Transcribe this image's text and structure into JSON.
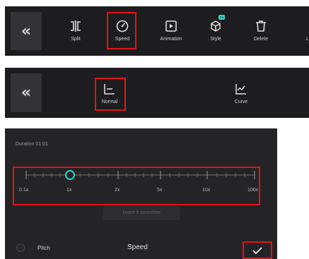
{
  "toolbar": {
    "back_icon": "double-chevron-left",
    "items": [
      {
        "label": "Split",
        "icon": "split-icon"
      },
      {
        "label": "Speed",
        "icon": "speedometer-icon"
      },
      {
        "label": "Animation",
        "icon": "animation-icon"
      },
      {
        "label": "Style",
        "icon": "style-cube-icon",
        "badge": "TV"
      },
      {
        "label": "Delete",
        "icon": "trash-icon"
      },
      {
        "label": "L",
        "icon": "none"
      }
    ]
  },
  "speed_mode": {
    "back_icon": "double-chevron-left",
    "options": [
      {
        "label": "Normal",
        "icon": "normal-chart-icon",
        "selected": true
      },
      {
        "label": "Curve",
        "icon": "curve-chart-icon",
        "selected": false
      }
    ]
  },
  "speed_panel": {
    "duration": "Duration 01:01",
    "slider": {
      "ticks": [
        "0.1x",
        "1x",
        "2x",
        "5x",
        "10x",
        "100x"
      ],
      "current": "1x"
    },
    "smooth_button": "Make it smoother",
    "pitch_label": "Pitch",
    "pitch_checked": false,
    "title": "Speed",
    "confirm_icon": "checkmark-icon"
  },
  "colors": {
    "panel_bg": "#1d1d1f",
    "highlight": "#e1141c",
    "accent": "#31d1c0"
  }
}
